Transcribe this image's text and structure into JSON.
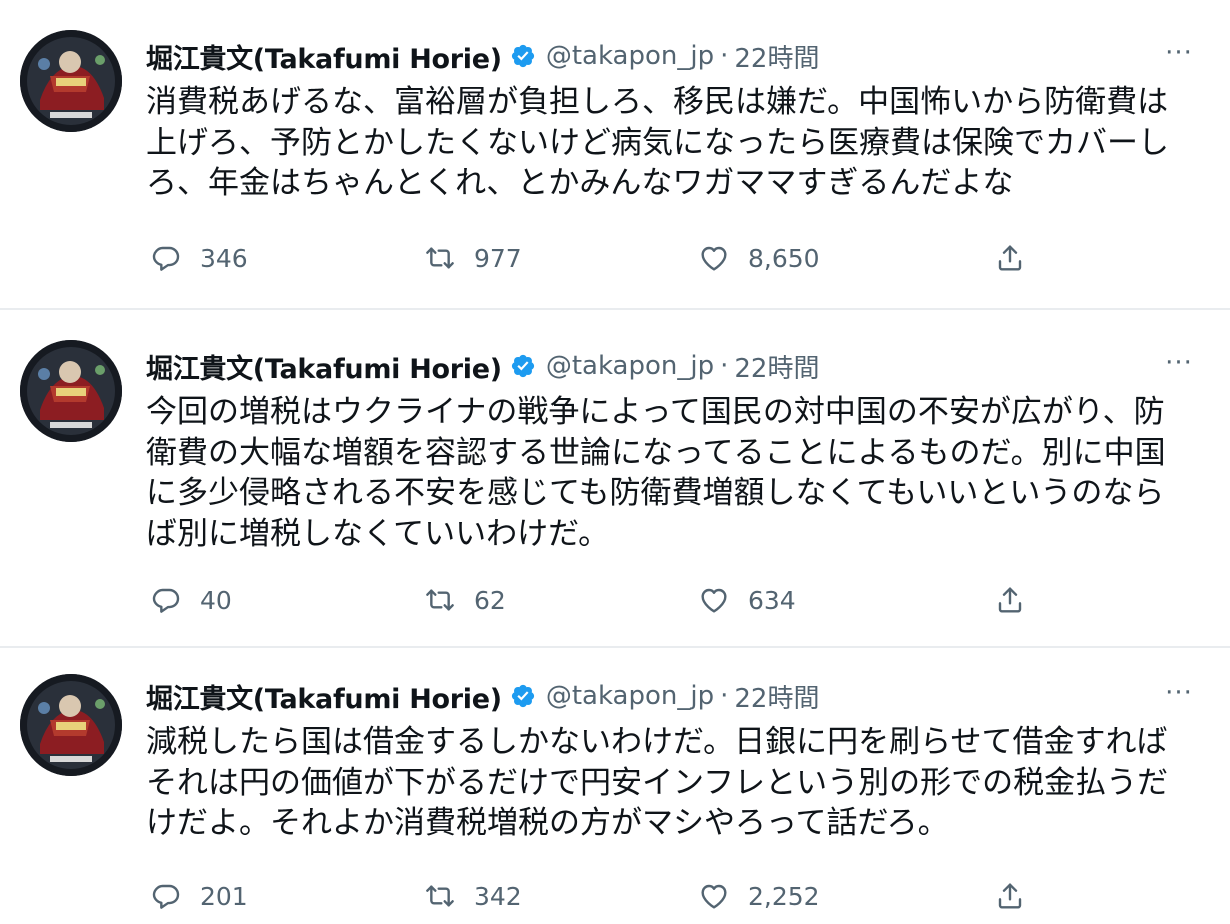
{
  "tweets": [
    {
      "author_name": "堀江貴文(Takafumi Horie)",
      "handle": "@takapon_jp",
      "separator": "·",
      "time": "22時間",
      "more": "···",
      "lines": [
        "消費税あげるな、富裕層が負担しろ、移民は嫌だ。中国怖いから防衛費は",
        "上げろ、予防とかしたくないけど病気になったら医療費は保険でカバーし",
        "ろ、年金はちゃんとくれ、とかみんなワガママすぎるんだよな"
      ],
      "replies": "346",
      "retweets": "977",
      "likes": "8,650"
    },
    {
      "author_name": "堀江貴文(Takafumi Horie)",
      "handle": "@takapon_jp",
      "separator": "·",
      "time": "22時間",
      "more": "···",
      "lines": [
        "今回の増税はウクライナの戦争によって国民の対中国の不安が広がり、防",
        "衛費の大幅な増額を容認する世論になってることによるものだ。別に中国",
        "に多少侵略される不安を感じても防衛費増額しなくてもいいというのなら",
        "ば別に増税しなくていいわけだ。"
      ],
      "replies": "40",
      "retweets": "62",
      "likes": "634"
    },
    {
      "author_name": "堀江貴文(Takafumi Horie)",
      "handle": "@takapon_jp",
      "separator": "·",
      "time": "22時間",
      "more": "···",
      "lines": [
        "減税したら国は借金するしかないわけだ。日銀に円を刷らせて借金すれば",
        "それは円の価値が下がるだけで円安インフレという別の形での税金払うだ",
        "けだよ。それよか消費税増税の方がマシやろって話だろ。"
      ],
      "replies": "201",
      "retweets": "342",
      "likes": "2,252"
    }
  ],
  "icons": {
    "reply": "reply-icon",
    "retweet": "retweet-icon",
    "like": "heart-icon",
    "share": "share-icon",
    "verified": "verified-badge-icon",
    "more": "more-icon"
  },
  "colors": {
    "text_primary": "#0f1419",
    "text_secondary": "#536471",
    "verified_blue": "#1d9bf0",
    "divider": "#e9ecef"
  }
}
